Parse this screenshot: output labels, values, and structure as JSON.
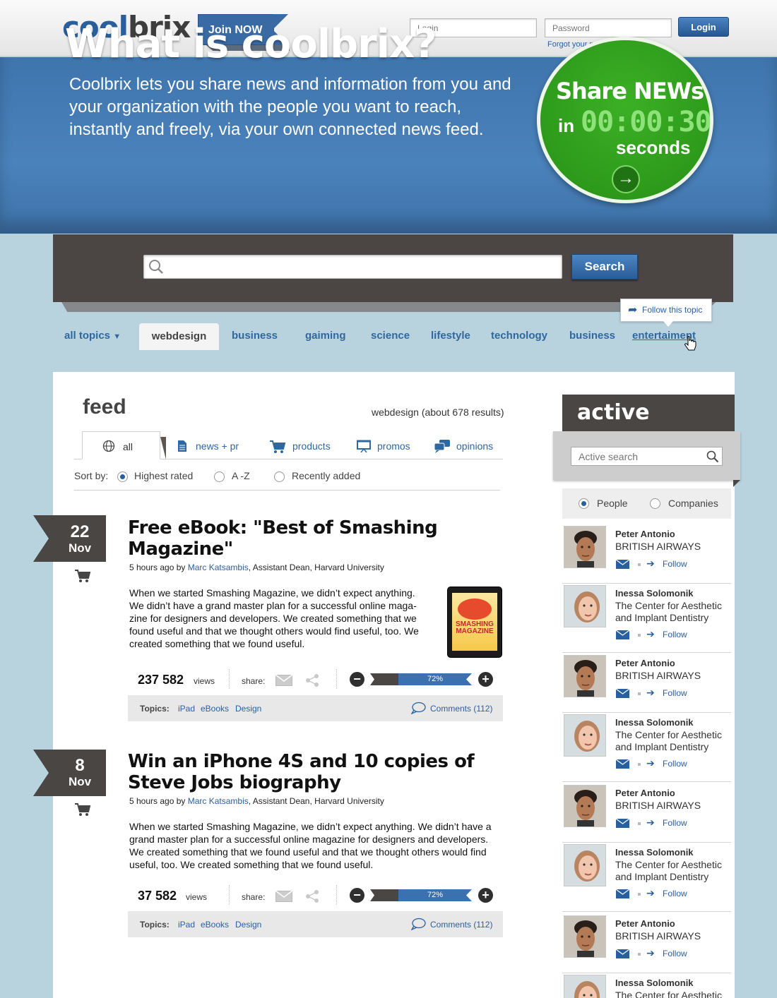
{
  "header": {
    "logo_part1": "cool",
    "logo_part2": "brix",
    "join_label": "Join NOW",
    "login_placeholder": "Login",
    "password_placeholder": "Password",
    "login_button": "Login",
    "forgot_label": "Forgot your password?"
  },
  "hero": {
    "title": "What is coolbrix?",
    "description": "Coolbrix lets you share news and information from you and your organization with the people you want to reach, instantly and freely, via your own connected news feed.",
    "badge_title": "Share NEWs",
    "badge_in": "in",
    "badge_timer": "00:00:30",
    "badge_seconds": "seconds"
  },
  "search": {
    "button_label": "Search",
    "placeholder": ""
  },
  "topics": {
    "all_label": "all topics",
    "items": [
      "webdesign",
      "business",
      "gaiming",
      "science",
      "lifestyle",
      "technology",
      "business",
      "entertaiment"
    ],
    "active": "webdesign",
    "follow_tip": "Follow this topic"
  },
  "feed": {
    "title": "feed",
    "results": "webdesign (about 678 results)",
    "tabs": [
      "all",
      "news + pr",
      "products",
      "promos",
      "opinions"
    ],
    "sort_label": "Sort by:",
    "sort_options": [
      "Highest rated",
      "A -Z",
      "Recently added"
    ],
    "sort_selected": "Highest rated",
    "posts": [
      {
        "day": "22",
        "month": "Nov",
        "title": "Free eBook: \"Best of Smashing Magazine\"",
        "time": "5 hours ago by ",
        "author": "Marc Katsambis",
        "author_role": ", Assistant Dean, Harvard University",
        "body": "When we started Smashing Magazine, we didn’t expect anything. We didn’t have a grand master plan for a successful online maga-zine for designers and developers. We created something that we found useful and that we thought others would find useful, too. We created something that we found useful.",
        "views": "237 582",
        "views_label": "views",
        "share_label": "share:",
        "rating": "72%",
        "topics_label": "Topics:",
        "topics": [
          "iPad",
          "eBooks",
          "Design"
        ],
        "comments": "Comments (112)",
        "image_text": "SMASHING MAGAZINE"
      },
      {
        "day": "8",
        "month": "Nov",
        "title": "Win an iPhone 4S and 10 copies of Steve Jobs biography",
        "time": "5 hours ago by ",
        "author": "Marc Katsambis",
        "author_role": ", Assistant Dean, Harvard University",
        "body": "When we started Smashing Magazine, we didn’t expect anything. We didn’t have a grand master plan for a successful online magazine for designers and developers. We created something that we found useful and that we thought others would find useful, too. We created something that we found useful.",
        "views": "37 582",
        "views_label": "views",
        "share_label": "share:",
        "rating": "72%",
        "topics_label": "Topics:",
        "topics": [
          "iPad",
          "eBooks",
          "Design"
        ],
        "comments": "Comments (112)"
      }
    ]
  },
  "active": {
    "title": "active",
    "search_placeholder": "Active search",
    "filters": [
      "People",
      "Companies"
    ],
    "filter_selected": "People",
    "follow_label": "Follow",
    "people": [
      {
        "name": "Peter Antonio",
        "org": "BRITISH AIRWAYS",
        "gender": "m"
      },
      {
        "name": "Inessa Solomonik",
        "org": "The Center for Aesthetic and Implant Dentistry",
        "gender": "f"
      },
      {
        "name": "Peter Antonio",
        "org": "BRITISH AIRWAYS",
        "gender": "m"
      },
      {
        "name": "Inessa Solomonik",
        "org": "The Center for Aesthetic and Implant Dentistry",
        "gender": "f"
      },
      {
        "name": "Peter Antonio",
        "org": "BRITISH AIRWAYS",
        "gender": "m"
      },
      {
        "name": "Inessa Solomonik",
        "org": "The Center for Aesthetic and Implant Dentistry",
        "gender": "f"
      },
      {
        "name": "Peter Antonio",
        "org": "BRITISH AIRWAYS",
        "gender": "m"
      },
      {
        "name": "Inessa Solomonik",
        "org": "The Center for Aesthetic",
        "gender": "f"
      }
    ]
  },
  "colors": {
    "brand_blue": "#2a5f9e",
    "dark": "#4a4644",
    "green": "#2e9a1b",
    "page_bg": "#b9d3de"
  }
}
